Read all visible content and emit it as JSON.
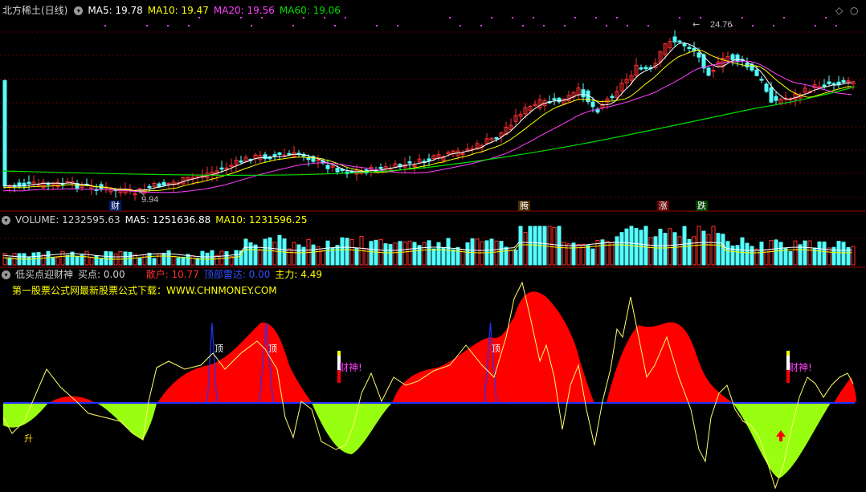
{
  "main": {
    "title": "北方稀土(日线)",
    "ma5": "MA5: 19.78",
    "ma10": "MA10: 19.47",
    "ma20": "MA20: 19.56",
    "ma60": "MA60: 19.06",
    "high_label": "24.76",
    "low_label": "9.94",
    "tags": {
      "cai": "财",
      "teng": "腾",
      "zhang": "涨",
      "die": "跌"
    },
    "colors": {
      "up": "#ff3030",
      "down": "#54ffff",
      "ma5": "#ffffff",
      "ma10": "#ffff00",
      "ma20": "#ff40ff",
      "ma60": "#00dd00"
    }
  },
  "volume": {
    "label": "VOLUME: 1232595.63",
    "ma5": "MA5: 1251636.88",
    "ma10": "MA10: 1231596.25"
  },
  "indicator": {
    "name": "低买点迎财神",
    "buy": "买点: 0.00",
    "retail": "散户: 10.77",
    "topfall": "顶部雷达: 0.00",
    "main_force": "主力: 4.49",
    "ad": "第一股票公式网最新股票公式下载：WWW.CHNMONEY.COM",
    "top_label": "顶",
    "caishen": "财神!",
    "rise": "升"
  },
  "controls": {
    "diamond": "◇",
    "close": "○"
  }
}
